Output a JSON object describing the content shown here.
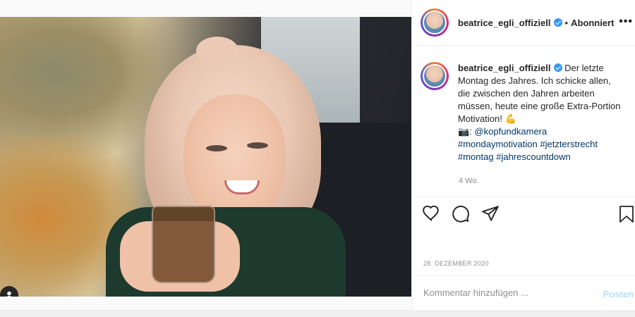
{
  "post": {
    "image_alt": "Woman smiling holding a cup of tea on a train",
    "author": {
      "username": "beatrice_egli_offiziell",
      "verified_icon": "verified-badge-icon"
    },
    "header": {
      "separator": "•",
      "follow_label": "Abonniert",
      "more_label": "•••"
    },
    "caption": {
      "username": "beatrice_egli_offiziell",
      "text_line1": " Der letzte Montag des Jahres. Ich schicke allen, die zwischen den Jahren arbeiten müssen, heute eine große Extra-Portion Motivation! ",
      "emoji_muscle": "💪",
      "camera_emoji": "📷",
      "credit_sep": ": ",
      "mention": "@kopfundkamera",
      "hashtags": [
        "#mondaymotivation",
        "#jetzterstrecht",
        "#montag",
        "#jahrescountdown"
      ],
      "age": "4 Wo."
    },
    "actions": {
      "like": "heart-icon",
      "comment": "comment-icon",
      "share": "share-icon",
      "save": "bookmark-icon"
    },
    "date": "28. DEZEMBER 2020",
    "comment": {
      "placeholder": "Kommentar hinzufügen ...",
      "post_label": "Posten"
    },
    "colors": {
      "link": "#00376b",
      "muted": "#8e8e8e",
      "post_button_disabled": "#b2dffc",
      "verified": "#3897f0"
    }
  }
}
